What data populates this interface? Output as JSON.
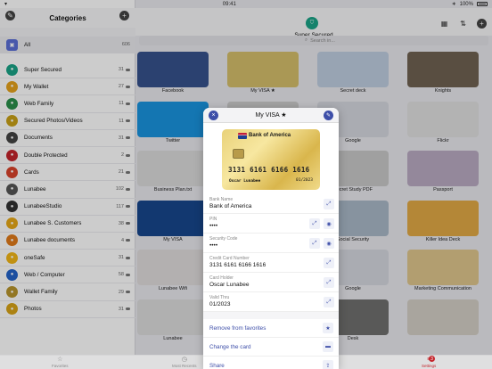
{
  "status": {
    "time": "09:41",
    "battery": "100%"
  },
  "sidebar": {
    "title": "Categories",
    "all": {
      "label": "All",
      "count": "606"
    },
    "items": [
      {
        "label": "Super Secured",
        "count": "31",
        "color": "#1aa386",
        "icon": "shield-icon"
      },
      {
        "label": "My Wallet",
        "count": "27",
        "color": "#e5a21c",
        "icon": "wallet-icon"
      },
      {
        "label": "Web Family",
        "count": "11",
        "color": "#2a8f4a",
        "icon": "family-icon"
      },
      {
        "label": "Secured Photos/Videos",
        "count": "11",
        "color": "#c8a017",
        "icon": "photos-icon"
      },
      {
        "label": "Documents",
        "count": "31",
        "color": "#444",
        "icon": "documents-icon"
      },
      {
        "label": "Double Protected",
        "count": "2",
        "color": "#c4242b",
        "icon": "lock-icon"
      },
      {
        "label": "Cards",
        "count": "21",
        "color": "#d9432b",
        "icon": "cards-icon"
      },
      {
        "label": "Lunabee",
        "count": "102",
        "color": "#555",
        "icon": "lunabee-icon"
      },
      {
        "label": "LunabeeStudio",
        "count": "117",
        "color": "#333",
        "icon": "studio-icon"
      },
      {
        "label": "Lunabee S. Customers",
        "count": "38",
        "color": "#e6a817",
        "icon": "customers-icon"
      },
      {
        "label": "Lunabee documents",
        "count": "4",
        "color": "#e07a1a",
        "icon": "folder-icon"
      },
      {
        "label": "oneSafe",
        "count": "31",
        "color": "#f2b617",
        "icon": "onesafe-icon"
      },
      {
        "label": "Web / Computer",
        "count": "58",
        "color": "#2463c9",
        "icon": "globe-icon"
      },
      {
        "label": "Wallet Family",
        "count": "29",
        "color": "#b8952e",
        "icon": "wallet-family-icon"
      },
      {
        "label": "Photos",
        "count": "31",
        "color": "#d8a317",
        "icon": "camera-icon"
      }
    ]
  },
  "header": {
    "title": "Super Secured",
    "search_placeholder": "Search in..."
  },
  "grid": [
    {
      "name": "Facebook",
      "bg": "#3b5998"
    },
    {
      "name": "My VISA ★",
      "bg": "#e8cf75"
    },
    {
      "name": "Secret deck",
      "bg": "#cfe0f3"
    },
    {
      "name": "Knights",
      "bg": "#7a6b5a"
    },
    {
      "name": "Twitter",
      "bg": "#1da1f2"
    },
    {
      "name": "",
      "bg": "#ddd"
    },
    {
      "name": "Google",
      "bg": "#e8ebf2"
    },
    {
      "name": "Flickr",
      "bg": "#f3f3f3"
    },
    {
      "name": "Business Plan.txt",
      "bg": "#eee"
    },
    {
      "name": "",
      "bg": "#ddd"
    },
    {
      "name": "Secret Study PDF",
      "bg": "#d9d9d9"
    },
    {
      "name": "Passport",
      "bg": "#c9b9d3"
    },
    {
      "name": "My VISA",
      "bg": "#1a4d9a"
    },
    {
      "name": "",
      "bg": "#ddd"
    },
    {
      "name": "Social Security",
      "bg": "#b8c8d8"
    },
    {
      "name": "Killer Idea Deck",
      "bg": "#f6b84b"
    },
    {
      "name": "Lunabee Wifi",
      "bg": "#f4f0ef"
    },
    {
      "name": "",
      "bg": "#ddd"
    },
    {
      "name": "Google",
      "bg": "#e8ebf2"
    },
    {
      "name": "Marketing Communication",
      "bg": "#f2d79a"
    },
    {
      "name": "Lunabee",
      "bg": "#f0f0f0"
    },
    {
      "name": "",
      "bg": "#ddd"
    },
    {
      "name": "Desk",
      "bg": "#7a7a78"
    },
    {
      "name": "",
      "bg": "#e6e1d7"
    }
  ],
  "tabs": [
    {
      "label": "Favorites",
      "icon": "star-icon"
    },
    {
      "label": "Most Recents",
      "icon": "clock-icon"
    },
    {
      "label": "Settings",
      "icon": "settings-icon",
      "badge": "3"
    }
  ],
  "modal": {
    "title": "My VISA ★",
    "card": {
      "bank": "Bank of America",
      "number": "3131 6161 6166 1616",
      "holder": "Oscar Lunabee",
      "expiry": "01/2023"
    },
    "fields": [
      {
        "label": "Bank Name",
        "value": "Bank of America"
      },
      {
        "label": "PIN",
        "value": "••••"
      },
      {
        "label": "Security Code",
        "value": "••••"
      },
      {
        "label": "Credit Card Number",
        "value": "3131 6161 6166 1616"
      },
      {
        "label": "Card Holder",
        "value": "Oscar Lunabee"
      },
      {
        "label": "Valid Thru",
        "value": "01/2023"
      }
    ],
    "actions": [
      {
        "label": "Remove from favorites"
      },
      {
        "label": "Change the card"
      },
      {
        "label": "Share"
      }
    ]
  }
}
